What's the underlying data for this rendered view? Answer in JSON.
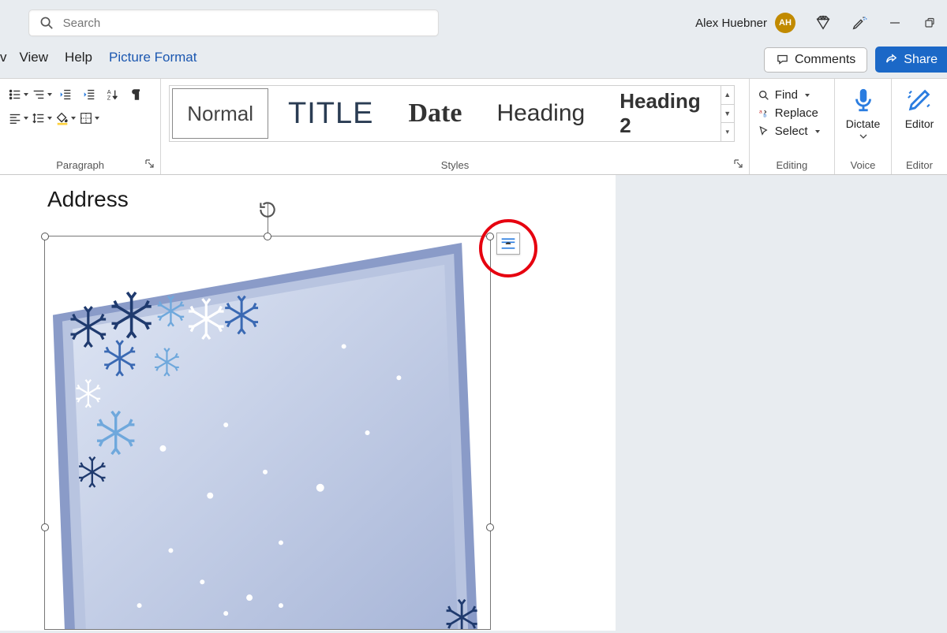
{
  "search": {
    "placeholder": "Search"
  },
  "user": {
    "name": "Alex Huebner",
    "initials": "AH"
  },
  "menu": {
    "tabs": [
      "v",
      "View",
      "Help",
      "Picture Format"
    ],
    "comments": "Comments",
    "share": "Share"
  },
  "ribbon": {
    "paragraph_label": "Paragraph",
    "styles_label": "Styles",
    "editing_label": "Editing",
    "voice_label": "Voice",
    "editor_label": "Editor",
    "styles": [
      "Normal",
      "TITLE",
      "Date",
      "Heading",
      "Heading 2"
    ],
    "editing": {
      "find": "Find",
      "replace": "Replace",
      "select": "Select"
    },
    "voice": "Dictate",
    "editor": "Editor"
  },
  "document": {
    "address_label": "Address"
  }
}
